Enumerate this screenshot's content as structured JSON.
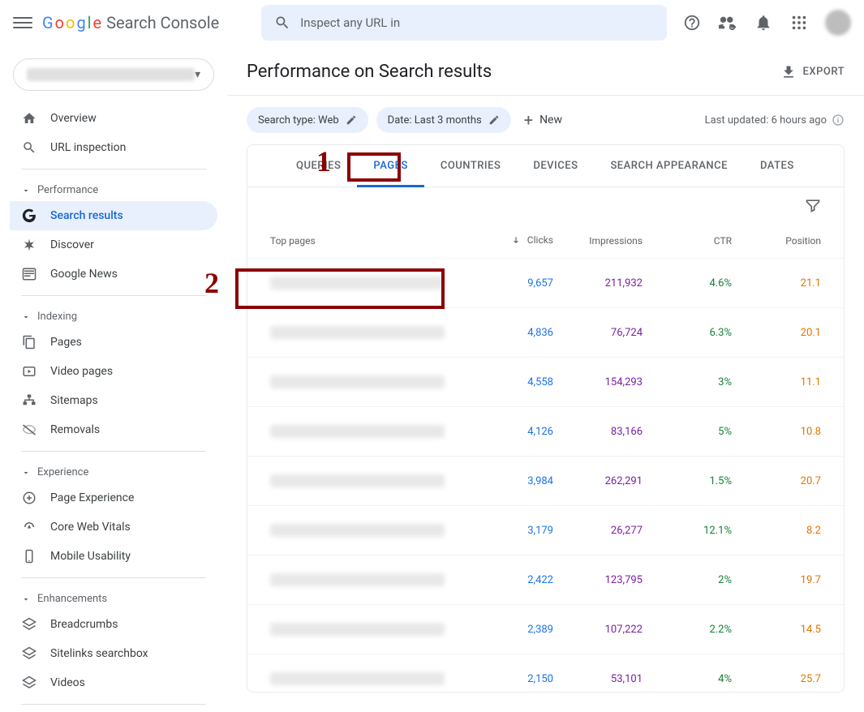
{
  "logo_text": "Search Console",
  "search": {
    "placeholder": "Inspect any URL in"
  },
  "export_label": "EXPORT",
  "page_title": "Performance on Search results",
  "filters": {
    "search_type": "Search type: Web",
    "date": "Date: Last 3 months",
    "new_label": "New"
  },
  "last_updated": "Last updated: 6 hours ago",
  "tabs": [
    "QUERIES",
    "PAGES",
    "COUNTRIES",
    "DEVICES",
    "SEARCH APPEARANCE",
    "DATES"
  ],
  "columns": {
    "page": "Top pages",
    "clicks": "Clicks",
    "impressions": "Impressions",
    "ctr": "CTR",
    "position": "Position"
  },
  "rows": [
    {
      "clicks": "9,657",
      "impressions": "211,932",
      "ctr": "4.6%",
      "position": "21.1"
    },
    {
      "clicks": "4,836",
      "impressions": "76,724",
      "ctr": "6.3%",
      "position": "20.1"
    },
    {
      "clicks": "4,558",
      "impressions": "154,293",
      "ctr": "3%",
      "position": "11.1"
    },
    {
      "clicks": "4,126",
      "impressions": "83,166",
      "ctr": "5%",
      "position": "10.8"
    },
    {
      "clicks": "3,984",
      "impressions": "262,291",
      "ctr": "1.5%",
      "position": "20.7"
    },
    {
      "clicks": "3,179",
      "impressions": "26,277",
      "ctr": "12.1%",
      "position": "8.2"
    },
    {
      "clicks": "2,422",
      "impressions": "123,795",
      "ctr": "2%",
      "position": "19.7"
    },
    {
      "clicks": "2,389",
      "impressions": "107,222",
      "ctr": "2.2%",
      "position": "14.5"
    },
    {
      "clicks": "2,150",
      "impressions": "53,101",
      "ctr": "4%",
      "position": "25.7"
    }
  ],
  "sidebar": {
    "overview": "Overview",
    "url_inspection": "URL inspection",
    "performance": "Performance",
    "search_results": "Search results",
    "discover": "Discover",
    "google_news": "Google News",
    "indexing": "Indexing",
    "pages": "Pages",
    "video_pages": "Video pages",
    "sitemaps": "Sitemaps",
    "removals": "Removals",
    "experience": "Experience",
    "page_experience": "Page Experience",
    "core_web_vitals": "Core Web Vitals",
    "mobile_usability": "Mobile Usability",
    "enhancements": "Enhancements",
    "breadcrumbs": "Breadcrumbs",
    "sitelinks": "Sitelinks searchbox",
    "videos": "Videos"
  },
  "annotations": {
    "one": "1",
    "two": "2"
  }
}
